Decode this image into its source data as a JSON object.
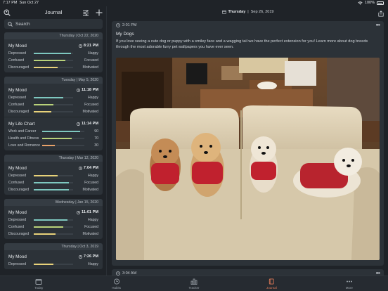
{
  "status": {
    "time": "7:17 PM",
    "date": "Sun Oct 27",
    "battery": "100%"
  },
  "sidebar": {
    "title": "Journal",
    "search_placeholder": "Search",
    "cards": [
      {
        "date": "Thursday | Oct 22, 2020",
        "entries": [
          {
            "title": "My Mood",
            "time": "8:21 PM",
            "metrics": [
              {
                "label": "Depressed",
                "value": "Happy",
                "fraction": 0.95,
                "color": "#7ec8c0"
              },
              {
                "label": "Confused",
                "value": "Focused",
                "fraction": 0.8,
                "color": "#b9d27a"
              },
              {
                "label": "Discouraged",
                "value": "Motivated",
                "fraction": 0.6,
                "color": "#e8d27a"
              }
            ]
          }
        ]
      },
      {
        "date": "Tuesday | May 5, 2020",
        "entries": [
          {
            "title": "My Mood",
            "time": "11:18 PM",
            "metrics": [
              {
                "label": "Depressed",
                "value": "Happy",
                "fraction": 0.75,
                "color": "#7ec8c0"
              },
              {
                "label": "Confused",
                "value": "Focused",
                "fraction": 0.5,
                "color": "#b9d27a"
              },
              {
                "label": "Discouraged",
                "value": "Motivated",
                "fraction": 0.45,
                "color": "#e8d27a"
              }
            ]
          },
          {
            "title": "My Life Chart",
            "time": "11:14 PM",
            "metrics": [
              {
                "label": "Work and Career",
                "value": "90",
                "fraction": 0.9,
                "color": "#7ec8c0"
              },
              {
                "label": "Health and Fitness",
                "value": "70",
                "fraction": 0.7,
                "color": "#b9d27a"
              },
              {
                "label": "Love and Romance",
                "value": "30",
                "fraction": 0.3,
                "color": "#e8a26a"
              }
            ]
          }
        ]
      },
      {
        "date": "Thursday | Mar 12, 2020",
        "entries": [
          {
            "title": "My Mood",
            "time": "7:04 PM",
            "metrics": [
              {
                "label": "Depressed",
                "value": "Happy",
                "fraction": 0.6,
                "color": "#e8d27a"
              },
              {
                "label": "Confused",
                "value": "Focused",
                "fraction": 0.9,
                "color": "#7ec8c0"
              },
              {
                "label": "Discouraged",
                "value": "Motivated",
                "fraction": 0.9,
                "color": "#7ec8c0"
              }
            ]
          }
        ]
      },
      {
        "date": "Wednesday | Jan 15, 2020",
        "entries": [
          {
            "title": "My Mood",
            "time": "11:01 PM",
            "metrics": [
              {
                "label": "Depressed",
                "value": "Happy",
                "fraction": 0.85,
                "color": "#7ec8c0"
              },
              {
                "label": "Confused",
                "value": "Focused",
                "fraction": 0.75,
                "color": "#b9d27a"
              },
              {
                "label": "Discouraged",
                "value": "Motivated",
                "fraction": 0.55,
                "color": "#e8d27a"
              }
            ]
          }
        ]
      },
      {
        "date": "Thursday | Oct 3, 2019",
        "entries": [
          {
            "title": "My Mood",
            "time": "7:26 PM",
            "metrics": [
              {
                "label": "Depressed",
                "value": "Happy",
                "fraction": 0.5,
                "color": "#e8d27a"
              }
            ]
          }
        ]
      }
    ]
  },
  "main": {
    "header_day": "Thursday",
    "header_date": "Sep 26, 2019",
    "entry": {
      "time": "2:01 PM",
      "title": "My Dogs",
      "body": "If you love seeing a cute dog or puppy with a smiley face and a wagging tail we have the perfect extension for you! Learn more about dog breeds through the most adorable furry pet wallpapers you have ever seen."
    },
    "next_entry_time": "3:04 AM"
  },
  "tabs": [
    {
      "label": "Today",
      "icon": "today-icon",
      "active": false
    },
    {
      "label": "Habits",
      "icon": "history-icon",
      "active": false
    },
    {
      "label": "Tracker",
      "icon": "tracker-icon",
      "active": false
    },
    {
      "label": "Journal",
      "icon": "journal-icon",
      "active": true
    },
    {
      "label": "More",
      "icon": "more-icon",
      "active": false
    }
  ],
  "colors": {
    "accent": "#e07a58",
    "card": "#2c3238",
    "background": "#1f2328"
  }
}
